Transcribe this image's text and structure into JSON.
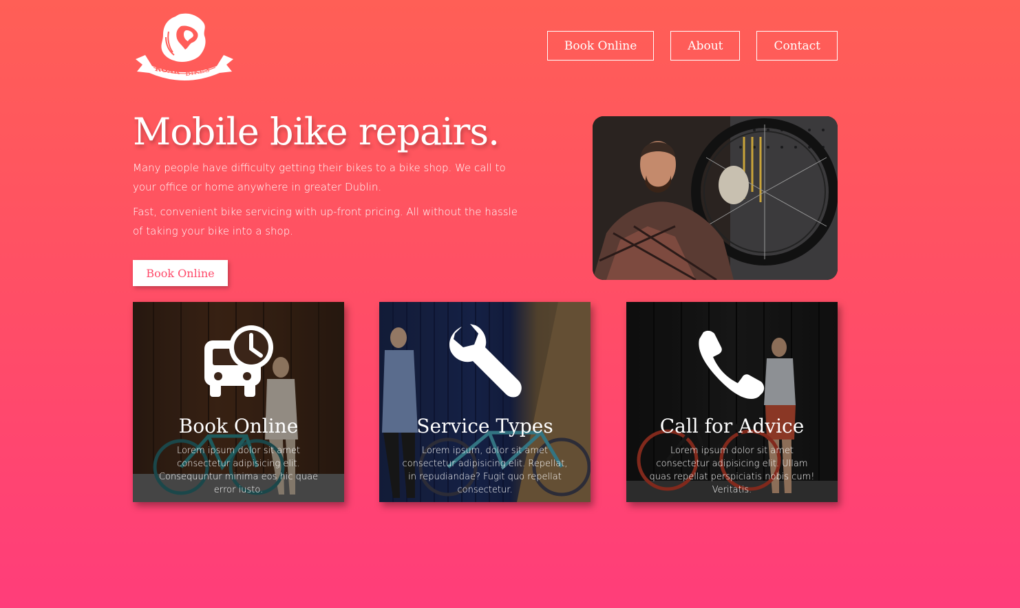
{
  "brand": {
    "logo_text_1": "ROAR",
    "logo_text_2": "BIKES"
  },
  "nav": [
    {
      "label": "Book Online"
    },
    {
      "label": "About"
    },
    {
      "label": "Contact"
    }
  ],
  "hero": {
    "title": "Mobile bike repairs.",
    "paragraph_1": "Many people have difficulty getting their bikes to a bike shop. We call to your office or home anywhere in greater Dublin.",
    "paragraph_2": "Fast, convenient bike servicing with up-front pricing. All without the hassle of taking your bike into a shop.",
    "button": "Book Online"
  },
  "cards": [
    {
      "title": "Book Online",
      "text": "Lorem ipsum dolor sit amet consectetur adipisicing elit. Consequuntur minima eos hic quae error iusto.",
      "icon": "bus-clock-icon"
    },
    {
      "title": "Service Types",
      "text": "Lorem ipsum, dolor sit amet consectetur adipisicing elit. Repellat, in repudiandae? Fugit quo repellat consectetur.",
      "icon": "wrench-icon"
    },
    {
      "title": "Call for Advice",
      "text": "Lorem ipsum dolor sit amet consectetur adipisicing elit. Ullam quas repellat perspiciatis nobis cum! Veritatis.",
      "icon": "phone-icon"
    }
  ],
  "colors": {
    "gradient_top": "#ff5f56",
    "gradient_bottom": "#ff3d7a",
    "button_text": "#ff4a6a"
  }
}
